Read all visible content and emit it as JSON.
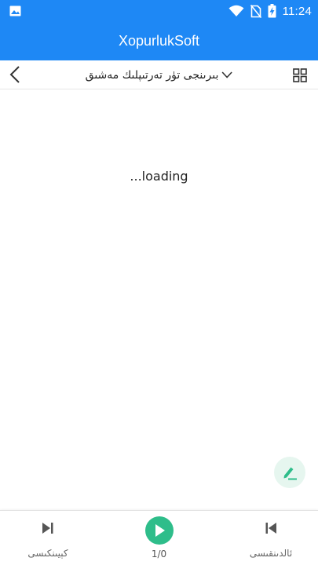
{
  "status_bar": {
    "time": "11:24",
    "icons": [
      "image-icon",
      "wifi-icon",
      "no-sim-icon",
      "battery-charging-icon"
    ]
  },
  "app_bar": {
    "title": "XopurlukSoft"
  },
  "toolbar": {
    "exam_title": "بىرىنجى تۈر تەرتىپلىك مەشىق",
    "icons": [
      "back-chevron-icon",
      "chevron-down-icon",
      "grid-icon"
    ]
  },
  "content": {
    "loading_text": "...loading"
  },
  "fab": {
    "icon": "edit-pen-icon"
  },
  "bottom_nav": {
    "next_label": "كېيىنكىسى",
    "prev_label": "ئالدىنقىسى",
    "counter": "1/0",
    "icons": [
      "skip-next-icon",
      "play-icon",
      "skip-previous-icon"
    ]
  },
  "colors": {
    "primary": "#1e88f5",
    "accent": "#2ebd8a",
    "fab_bg": "#e6f6ef"
  }
}
